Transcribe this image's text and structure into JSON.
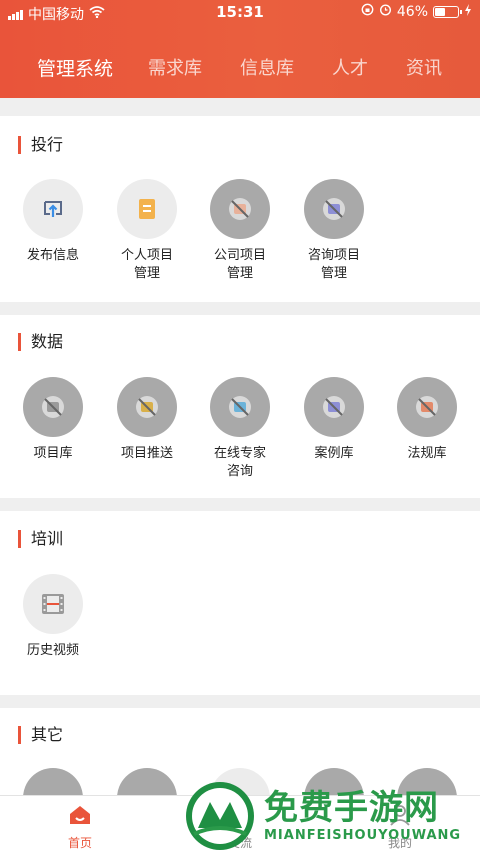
{
  "status_bar": {
    "carrier": "中国移动",
    "time": "15:31",
    "battery": "46%",
    "battery_level": 0.46
  },
  "nav": {
    "tabs": [
      "管理系统",
      "需求库",
      "信息库",
      "人才",
      "资讯"
    ],
    "active": 0
  },
  "sections": [
    {
      "title": "投行",
      "items": [
        {
          "label1": "发布信息",
          "label2": ""
        },
        {
          "label1": "个人项目",
          "label2": "管理"
        },
        {
          "label1": "公司项目",
          "label2": "管理"
        },
        {
          "label1": "咨询项目",
          "label2": "管理"
        }
      ]
    },
    {
      "title": "数据",
      "items": [
        {
          "label1": "项目库",
          "label2": ""
        },
        {
          "label1": "项目推送",
          "label2": ""
        },
        {
          "label1": "在线专家",
          "label2": "咨询"
        },
        {
          "label1": "案例库",
          "label2": ""
        },
        {
          "label1": "法规库",
          "label2": ""
        }
      ]
    },
    {
      "title": "培训",
      "items": [
        {
          "label1": "历史视频",
          "label2": ""
        }
      ]
    },
    {
      "title": "其它",
      "items": []
    }
  ],
  "tabbar": {
    "tabs": [
      "首页",
      "交流",
      "我的"
    ],
    "active": 0
  },
  "watermark": {
    "text": "免费手游网",
    "sub": "MIANFEISHOUYOUWANG"
  },
  "colors": {
    "accent": "#e9543a",
    "icon_gray": "#a9a9a9",
    "icon_light": "#ececec"
  }
}
